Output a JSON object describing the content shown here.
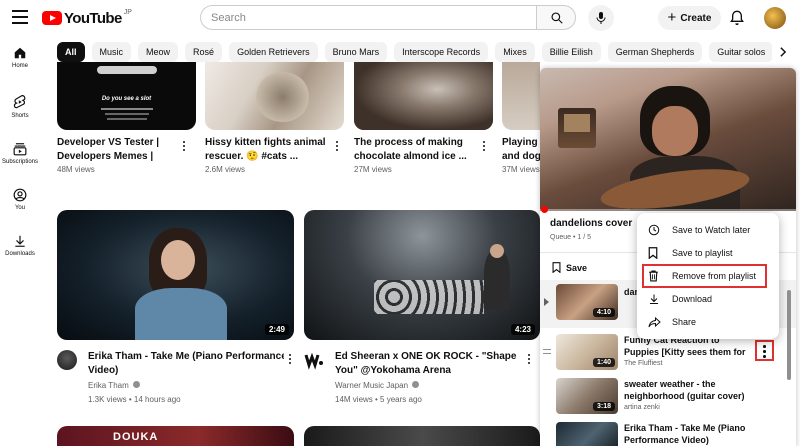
{
  "header": {
    "logo_text": "YouTube",
    "logo_region": "JP",
    "search_placeholder": "Search",
    "create_label": "Create"
  },
  "nav": {
    "items": [
      {
        "label": "Home",
        "icon": "home-icon"
      },
      {
        "label": "Shorts",
        "icon": "shorts-icon"
      },
      {
        "label": "Subscriptions",
        "icon": "subscriptions-icon"
      },
      {
        "label": "You",
        "icon": "you-icon"
      },
      {
        "label": "Downloads",
        "icon": "download-icon"
      }
    ]
  },
  "chips": [
    "All",
    "Music",
    "Meow",
    "Rosé",
    "Golden Retrievers",
    "Bruno Mars",
    "Interscope Records",
    "Mixes",
    "Billie Eilish",
    "German Shepherds",
    "Guitar solos"
  ],
  "top_row": [
    {
      "title_line1": "Developer VS Tester |",
      "title_line2": "Developers Memes |",
      "meta": "48M views",
      "thumb_text1": "Do you see a slot"
    },
    {
      "title_line1": "Hissy kitten fights animal",
      "title_line2": "rescuer. 🤨 #cats ...",
      "meta": "2.6M views"
    },
    {
      "title_line1": "The process of making",
      "title_line2": "chocolate almond ice ...",
      "meta": "27M views"
    },
    {
      "title_line1": "Playing p",
      "title_line2": "and dog",
      "meta": "37M views"
    }
  ],
  "mid_row": [
    {
      "title_line1": "Erika Tham - Take Me (Piano Performance",
      "title_line2": "Video)",
      "channel": "Erika Tham",
      "meta": "1.3K views • 14 hours ago",
      "duration": "2:49"
    },
    {
      "title_line1": "Ed Sheeran x ONE OK ROCK - \"Shape of",
      "title_line2": "You\" @Yokohama Arena",
      "channel": "Warner Music Japan",
      "meta": "14M views • 5 years ago",
      "duration": "4:23"
    }
  ],
  "bottom_row": [
    {
      "thumb_text": "DOUKA"
    }
  ],
  "mini_player": {
    "title": "dandelions cover",
    "queue": "Queue • 1 / 5",
    "save_label": "Save",
    "playlist": [
      {
        "title": "dan",
        "sub": "",
        "duration": "4:10"
      },
      {
        "title": "Funny Cat Reaction to Puppies [Kitty sees them for the First...",
        "sub": "The Fluffiest",
        "duration": "1:40"
      },
      {
        "title": "sweater weather - the neighborhood (guitar cover)",
        "sub": "artina zenki",
        "duration": "3:18"
      },
      {
        "title": "Erika Tham - Take Me (Piano Performance Video)",
        "sub": "",
        "duration": ""
      }
    ]
  },
  "context_menu": {
    "items": [
      {
        "label": "Save to Watch later",
        "icon": "clock-icon"
      },
      {
        "label": "Save to playlist",
        "icon": "bookmark-icon"
      },
      {
        "label": "Remove from playlist",
        "icon": "trash-icon"
      },
      {
        "label": "Download",
        "icon": "download-icon"
      },
      {
        "label": "Share",
        "icon": "share-icon"
      }
    ]
  },
  "colors": {
    "brand_red": "#ff0000",
    "highlight_red": "#e03030",
    "text_primary": "#0f0f0f",
    "text_secondary": "#606060",
    "chip_bg": "#f2f2f2"
  }
}
